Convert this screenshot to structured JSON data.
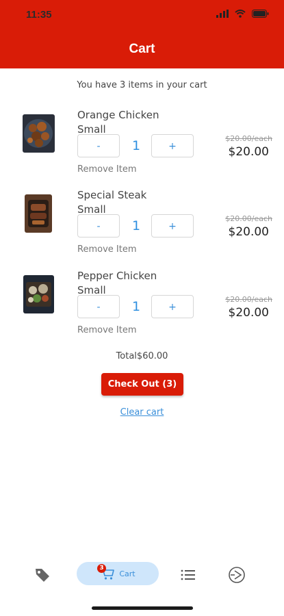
{
  "status_bar": {
    "time": "11:35"
  },
  "header": {
    "title": "Cart"
  },
  "summary": "You have 3 items in your cart",
  "items": [
    {
      "name": "Orange Chicken",
      "size": "Small",
      "decrement": "-",
      "quantity": "1",
      "increment": "+",
      "remove": "Remove Item",
      "each": "$20.00/each",
      "price": "$20.00"
    },
    {
      "name": "Special Steak",
      "size": "Small",
      "decrement": "-",
      "quantity": "1",
      "increment": "+",
      "remove": "Remove Item",
      "each": "$20.00/each",
      "price": "$20.00"
    },
    {
      "name": "Pepper Chicken",
      "size": "Small",
      "decrement": "-",
      "quantity": "1",
      "increment": "+",
      "remove": "Remove Item",
      "each": "$20.00/each",
      "price": "$20.00"
    }
  ],
  "total": "Total$60.00",
  "checkout": "Check Out (3)",
  "clear": "Clear cart",
  "tabbar": {
    "tabs": [
      {
        "icon": "tag-icon"
      },
      {
        "icon": "cart-icon",
        "label": "Cart",
        "badge": "3",
        "active": true
      },
      {
        "icon": "list-icon"
      },
      {
        "icon": "play-circle-icon"
      }
    ]
  },
  "colors": {
    "brand": "#d91c07",
    "accent": "#3a8fd9",
    "active_tab_bg": "#cfe6fb"
  }
}
